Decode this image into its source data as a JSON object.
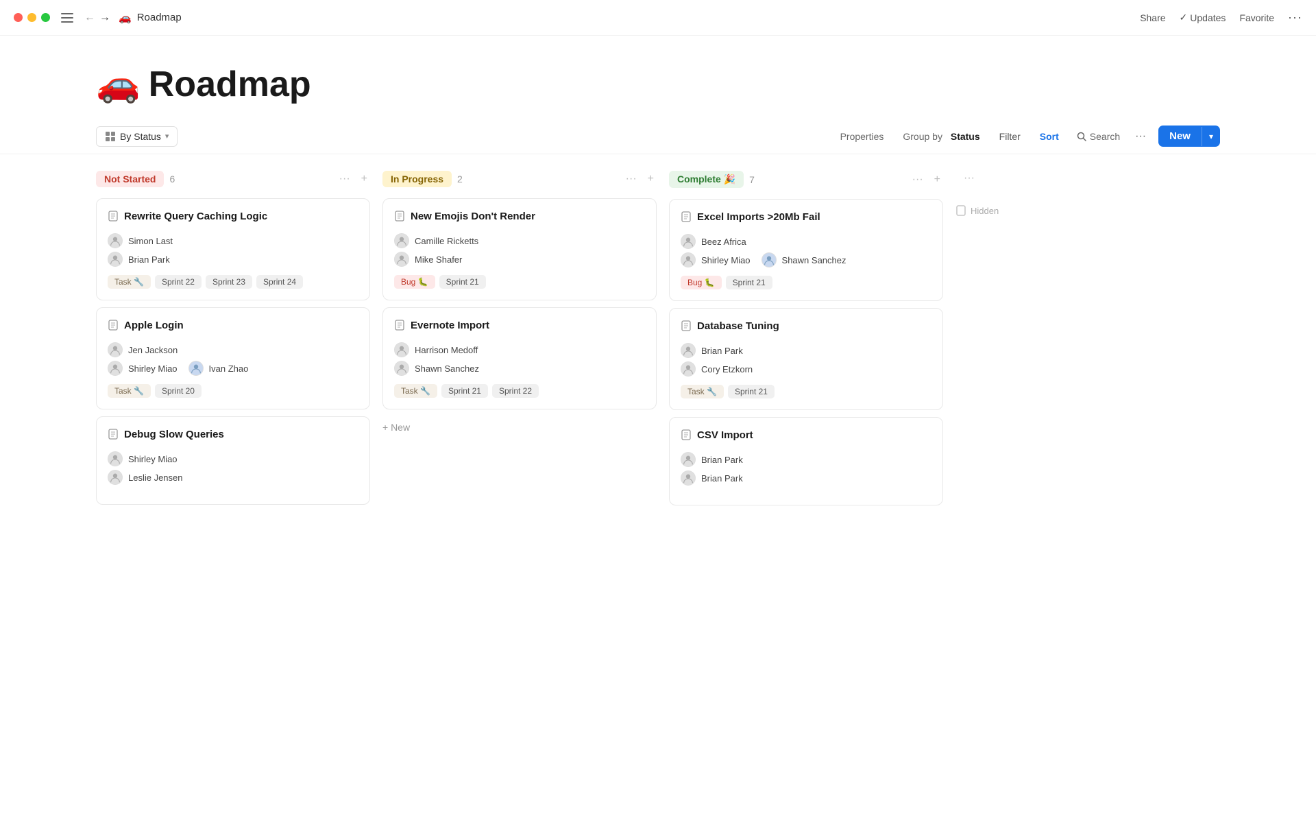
{
  "titlebar": {
    "page_emoji": "🚗",
    "page_title": "Roadmap",
    "share_label": "Share",
    "updates_label": "Updates",
    "favorite_label": "Favorite"
  },
  "page_header": {
    "emoji": "🚗",
    "title": "Roadmap"
  },
  "toolbar": {
    "by_status_label": "By Status",
    "properties_label": "Properties",
    "group_by_label": "Group by",
    "group_by_bold": "Status",
    "filter_label": "Filter",
    "sort_label": "Sort",
    "search_label": "Search",
    "more_label": "···",
    "new_label": "New",
    "new_arrow": "▾"
  },
  "columns": [
    {
      "id": "not-started",
      "status_label": "Not Started",
      "status_class": "status-not-started",
      "count": 6,
      "cards": [
        {
          "title": "Rewrite Query Caching Logic",
          "assignees": [
            {
              "name": "Simon Last"
            },
            {
              "name": "Brian Park"
            }
          ],
          "tags": [
            {
              "label": "Task 🔧",
              "type": "task"
            }
          ],
          "sprints": [
            "Sprint 22",
            "Sprint 23",
            "Sprint 24"
          ]
        },
        {
          "title": "Apple Login",
          "assignees": [
            {
              "name": "Jen Jackson"
            },
            {
              "name": "Shirley Miao"
            },
            {
              "name": "Ivan Zhao"
            }
          ],
          "tags": [
            {
              "label": "Task 🔧",
              "type": "task"
            }
          ],
          "sprints": [
            "Sprint 20"
          ]
        },
        {
          "title": "Debug Slow Queries",
          "assignees": [
            {
              "name": "Shirley Miao"
            },
            {
              "name": "Leslie Jensen"
            }
          ],
          "tags": [],
          "sprints": []
        }
      ]
    },
    {
      "id": "in-progress",
      "status_label": "In Progress",
      "status_class": "status-in-progress",
      "count": 2,
      "cards": [
        {
          "title": "New Emojis Don't Render",
          "assignees": [
            {
              "name": "Camille Ricketts"
            },
            {
              "name": "Mike Shafer"
            }
          ],
          "tags": [
            {
              "label": "Bug 🐛",
              "type": "bug"
            }
          ],
          "sprints": [
            "Sprint 21"
          ]
        },
        {
          "title": "Evernote Import",
          "assignees": [
            {
              "name": "Harrison Medoff"
            },
            {
              "name": "Shawn Sanchez"
            }
          ],
          "tags": [
            {
              "label": "Task 🔧",
              "type": "task"
            }
          ],
          "sprints": [
            "Sprint 21",
            "Sprint 22"
          ]
        }
      ],
      "new_card_label": "+ New"
    },
    {
      "id": "complete",
      "status_label": "Complete 🎉",
      "status_class": "status-complete",
      "count": 7,
      "cards": [
        {
          "title": "Excel Imports >20Mb Fail",
          "assignees": [
            {
              "name": "Beez Africa"
            },
            {
              "name": "Shirley Miao"
            },
            {
              "name": "Shawn Sanchez"
            }
          ],
          "tags": [
            {
              "label": "Bug 🐛",
              "type": "bug"
            }
          ],
          "sprints": [
            "Sprint 21"
          ]
        },
        {
          "title": "Database Tuning",
          "assignees": [
            {
              "name": "Brian Park"
            },
            {
              "name": "Cory Etzkorn"
            }
          ],
          "tags": [
            {
              "label": "Task 🔧",
              "type": "task"
            }
          ],
          "sprints": [
            "Sprint 21"
          ]
        },
        {
          "title": "CSV Import",
          "assignees": [
            {
              "name": "Brian Park"
            },
            {
              "name": "Brian Park"
            }
          ],
          "tags": [],
          "sprints": []
        }
      ]
    }
  ],
  "hidden_column": {
    "label": "Hidden"
  }
}
